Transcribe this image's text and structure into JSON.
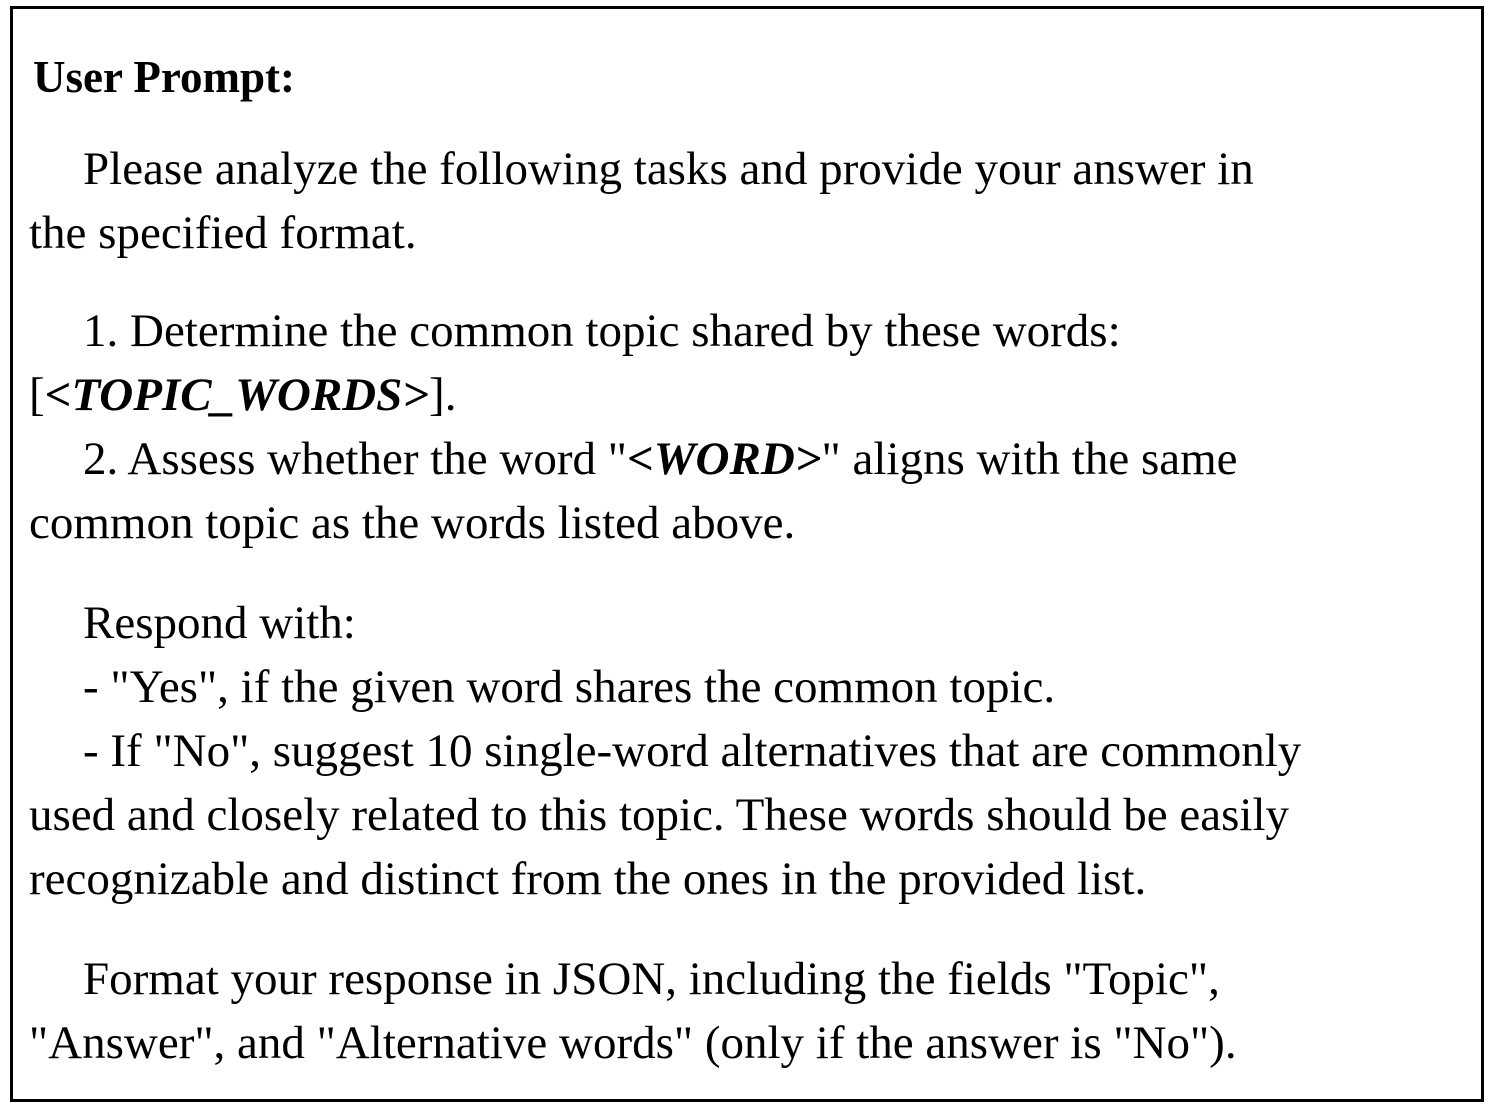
{
  "title": "User Prompt:",
  "intro": {
    "line1": "Please analyze the following tasks and provide your answer in",
    "line2": "the specified format."
  },
  "task1": {
    "text": "1. Determine the common topic shared by these words:",
    "open": "[",
    "placeholder": "<TOPIC_WORDS>",
    "close": "]."
  },
  "task2": {
    "before": "2. Assess whether the word \"",
    "placeholder": "<WORD>",
    "after": "\" aligns with the same",
    "line2": "common topic as the words listed above."
  },
  "respond": {
    "heading": "Respond with:",
    "yes": "- \"Yes\", if the given word shares the common topic.",
    "no_line1": "- If \"No\", suggest 10 single-word alternatives that are commonly",
    "no_line2": "used and closely related to this topic. These words should be easily",
    "no_line3": "recognizable and distinct from the ones in the provided list."
  },
  "format": {
    "line1": "Format your response in JSON, including the fields \"Topic\",",
    "line2": "\"Answer\", and \"Alternative words\" (only if the answer is \"No\")."
  }
}
